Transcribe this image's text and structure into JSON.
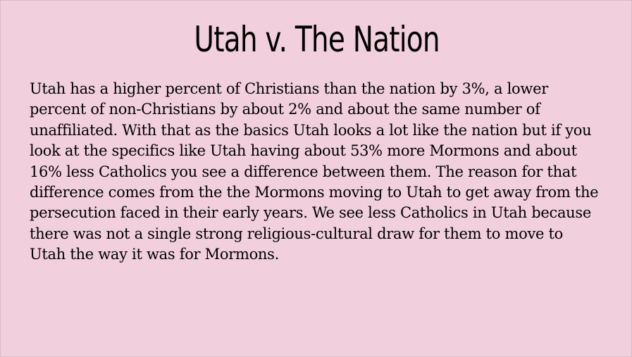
{
  "slide": {
    "background_color": "#f1cfdc",
    "title": "Utah v. The Nation",
    "body": "Utah has a higher percent of Christians than the nation by 3%, a lower percent of non-Christians by about 2% and about the same number of unaffiliated. With that as the basics Utah looks a lot like the nation but if you look at the specifics like Utah having about 53% more Mormons and about 16% less Catholics you see a difference between them. The reason for that difference comes from the the Mormons moving to Utah to get away from the persecution faced in their early years. We see less Catholics in Utah because there was not a single strong religious-cultural draw for them to move to Utah the way it was for Mormons."
  }
}
